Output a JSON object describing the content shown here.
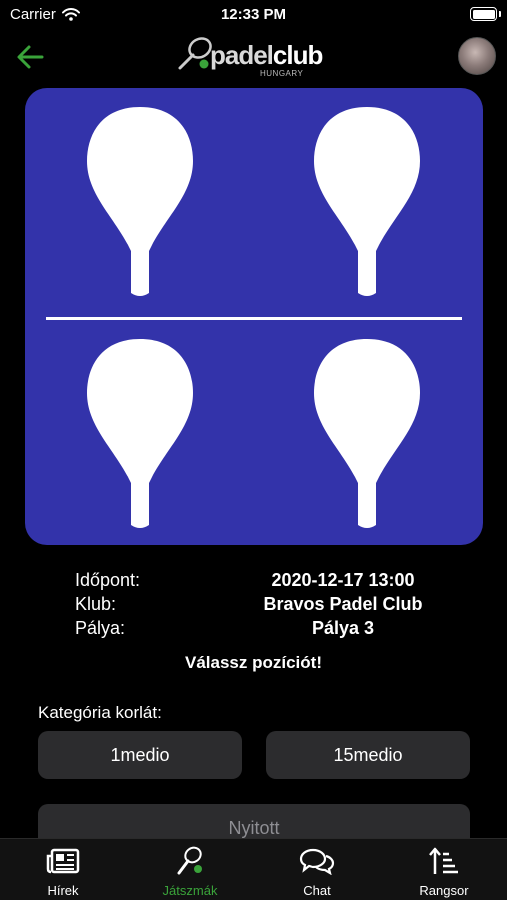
{
  "status_bar": {
    "carrier": "Carrier",
    "time": "12:33 PM"
  },
  "header": {
    "logo": {
      "name_left": "padel",
      "name_right": "club",
      "tagline": "HUNGARY"
    },
    "back_icon": "arrow-left-icon",
    "avatar": "user-avatar"
  },
  "court": {
    "color": "#3333aa",
    "positions": 4
  },
  "match": {
    "time_label": "Időpont:",
    "time_value": "2020-12-17 13:00",
    "club_label": "Klub:",
    "club_value": "Bravos Padel Club",
    "court_label": "Pálya:",
    "court_value": "Pálya 3"
  },
  "prompt": "Válassz pozíciót!",
  "category": {
    "label": "Kategória korlát:",
    "min": "1medio",
    "max": "15medio"
  },
  "status_button": "Nyitott",
  "tabs": [
    {
      "label": "Hírek",
      "icon": "newspaper-icon",
      "active": false
    },
    {
      "label": "Játszmák",
      "icon": "padel-racket-icon",
      "active": true
    },
    {
      "label": "Chat",
      "icon": "chat-bubbles-icon",
      "active": false
    },
    {
      "label": "Rangsor",
      "icon": "ranking-sort-icon",
      "active": false
    }
  ],
  "colors": {
    "accent": "#3aa33a",
    "background": "#000000",
    "button": "#2c2c2e"
  }
}
